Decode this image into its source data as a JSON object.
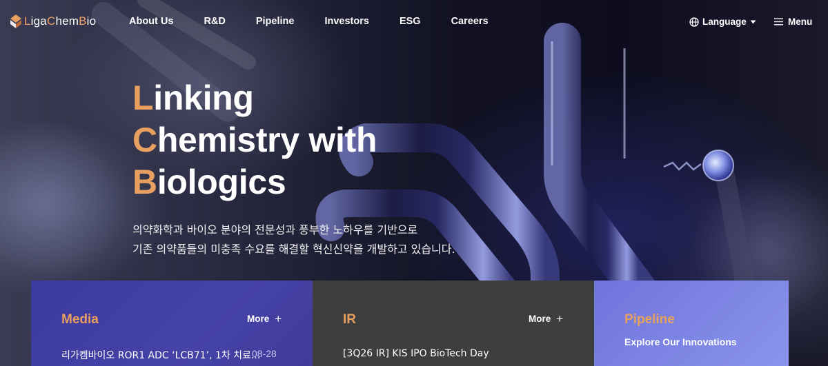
{
  "brand": {
    "logo_text_parts": [
      "L",
      "iga",
      "C",
      "hem",
      "B",
      "io"
    ],
    "accent_color": "#e8a060"
  },
  "nav": {
    "items": [
      "About Us",
      "R&D",
      "Pipeline",
      "Investors",
      "ESG",
      "Careers"
    ]
  },
  "header_right": {
    "language_label": "Language",
    "menu_label": "Menu",
    "language_icon": "globe-icon",
    "menu_icon": "hamburger-icon"
  },
  "hero": {
    "lines": [
      {
        "cap": "L",
        "rest": "inking"
      },
      {
        "cap": "C",
        "rest": "hemistry with"
      },
      {
        "cap": "B",
        "rest": "iologics"
      }
    ],
    "description_1": "의약화학과 바이오 분야의 전문성과 풍부한 노하우를 기반으로",
    "description_2": "기존 의약품들의 미충족 수요를 해결할 혁신신약을 개발하고 있습니다."
  },
  "cards": {
    "media": {
      "title": "Media",
      "more_label": "More",
      "item_title": "리가켐바이오 ROR1 ADC ‘LCB71’, 1차 치료...",
      "item_date": "08-28",
      "color": "#4240a6"
    },
    "ir": {
      "title": "IR",
      "more_label": "More",
      "item_title": "[3Q26 IR] KIS IPO BioTech Day",
      "color": "#3e3e3f"
    },
    "pipeline": {
      "title": "Pipeline",
      "subtitle": "Explore Our Innovations",
      "color": "#7c84e4"
    }
  }
}
